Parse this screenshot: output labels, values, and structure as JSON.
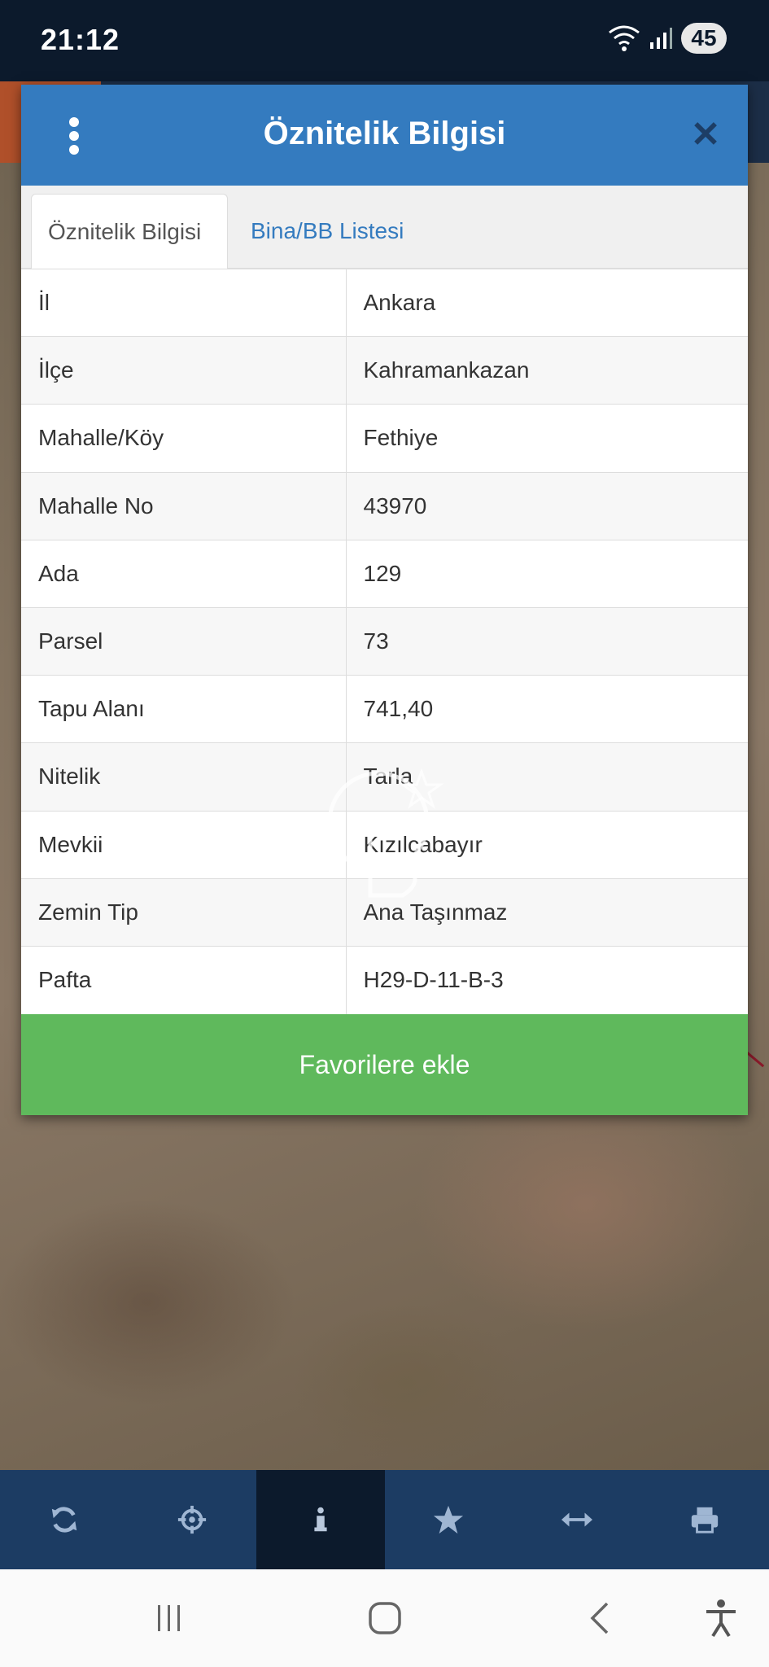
{
  "status": {
    "time": "21:12",
    "battery": "45"
  },
  "dialog": {
    "title": "Öznitelik Bilgisi",
    "tabs": [
      {
        "label": "Öznitelik Bilgisi",
        "active": true
      },
      {
        "label": "Bina/BB Listesi",
        "active": false
      }
    ],
    "rows": [
      {
        "key": "İl",
        "value": "Ankara"
      },
      {
        "key": "İlçe",
        "value": "Kahramankazan"
      },
      {
        "key": "Mahalle/Köy",
        "value": "Fethiye"
      },
      {
        "key": "Mahalle No",
        "value": "43970"
      },
      {
        "key": "Ada",
        "value": "129"
      },
      {
        "key": "Parsel",
        "value": "73"
      },
      {
        "key": "Tapu Alanı",
        "value": "741,40"
      },
      {
        "key": "Nitelik",
        "value": "Tarla"
      },
      {
        "key": "Mevkii",
        "value": "Kızılcabayır"
      },
      {
        "key": "Zemin Tip",
        "value": "Ana Taşınmaz"
      },
      {
        "key": "Pafta",
        "value": "H29-D-11-B-3"
      }
    ],
    "favorite_button": "Favorilere ekle"
  },
  "toolbar": {
    "items": [
      {
        "icon": "refresh-icon"
      },
      {
        "icon": "crosshair-icon"
      },
      {
        "icon": "info-icon",
        "active": true
      },
      {
        "icon": "star-icon"
      },
      {
        "icon": "measure-icon"
      },
      {
        "icon": "print-icon"
      }
    ]
  },
  "nav": {
    "icons": [
      "recent-apps-icon",
      "home-icon",
      "back-icon",
      "accessibility-icon"
    ]
  },
  "colors": {
    "header": "#347bbf",
    "button": "#5fb95c",
    "toolbar": "#1c3c63",
    "toolbar_active": "#0c1a2c"
  }
}
